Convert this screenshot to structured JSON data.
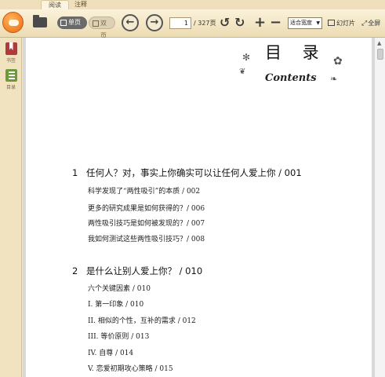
{
  "tabs": [
    {
      "label": "阅读"
    },
    {
      "label": "注释"
    }
  ],
  "toolbar": {
    "single_page_label": "单页",
    "double_page_label": "双页",
    "current_page": "1",
    "page_total": "/ 327页",
    "fit_option": "适合宽度",
    "slideshow_label": "幻灯片",
    "fullscreen_label": "全屏"
  },
  "sidebar": {
    "bookmark_label": "书签",
    "toc_label": "目录"
  },
  "document": {
    "title": "目 录",
    "subtitle": "Contents",
    "chapters": [
      {
        "number": "1",
        "title": "任何人？对，事实上你确实可以让任何人爱上你 / 001",
        "entries": [
          "科学发现了“两性吸引”的本质 / 002",
          "更多的研究成果是如何获得的？/ 006",
          "两性吸引技巧是如何被发现的？/ 007",
          "我如何测试这些两性吸引技巧？/ 008"
        ]
      },
      {
        "number": "2",
        "title": "是什么让别人爱上你？ / 010",
        "entries": [
          "六个关键因素 / 010",
          "I. 第一印象 / 010",
          "II. 相似的个性，互补的需求 / 012",
          "III. 等价原则 / 013",
          "IV. 自尊 / 014",
          "V. 恋爱初期攻心策略 / 015"
        ]
      }
    ]
  },
  "colors": {
    "chrome_bg": "#f3e6c6",
    "page_bg": "#ffffff",
    "logo_orange": "#e86a12"
  }
}
